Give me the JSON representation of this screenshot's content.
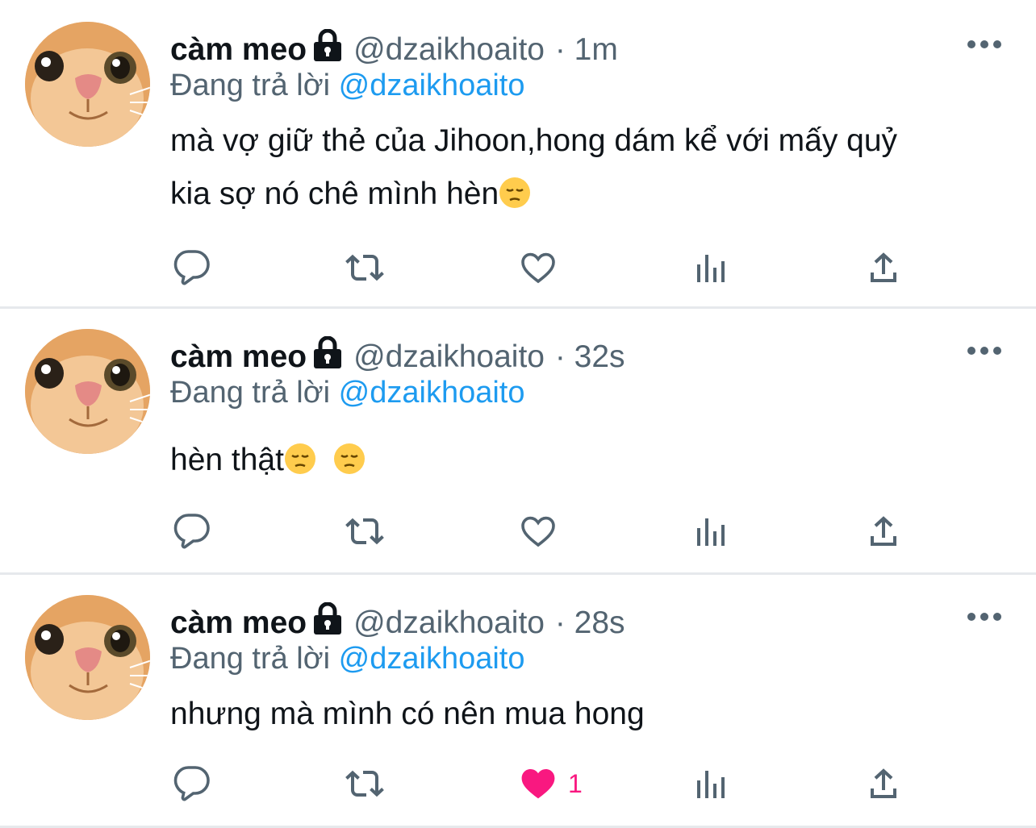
{
  "tweets": [
    {
      "name": "càm meo",
      "handle": "@dzaikhoaito",
      "time": "· 1m",
      "reply_prefix": "Đang trả lời",
      "reply_to": "@dzaikhoaito",
      "text_lines": [
        "mà vợ giữ thẻ của Jihoon,hong dám kể với mấy quỷ",
        "kia sợ nó chê mình hèn"
      ],
      "emoji": [
        "pensive-face"
      ],
      "liked": false,
      "like_count": ""
    },
    {
      "name": "càm meo",
      "handle": "@dzaikhoaito",
      "time": "· 32s",
      "reply_prefix": "Đang trả lời",
      "reply_to": "@dzaikhoaito",
      "text_lines": [
        "hèn thật"
      ],
      "emoji": [
        "pensive-face",
        "pensive-face"
      ],
      "liked": false,
      "like_count": ""
    },
    {
      "name": "càm meo",
      "handle": "@dzaikhoaito",
      "time": "· 28s",
      "reply_prefix": "Đang trả lời",
      "reply_to": "@dzaikhoaito",
      "text_lines": [
        "nhưng mà mình có nên mua hong"
      ],
      "emoji": [],
      "liked": true,
      "like_count": "1"
    }
  ],
  "icons": [
    "lock-icon",
    "more-icon",
    "reply-icon",
    "retweet-icon",
    "like-icon",
    "views-icon",
    "share-icon"
  ],
  "colors": {
    "link": "#1d9bf0",
    "muted": "#536471",
    "like": "#f91880",
    "icon": "#536471"
  }
}
